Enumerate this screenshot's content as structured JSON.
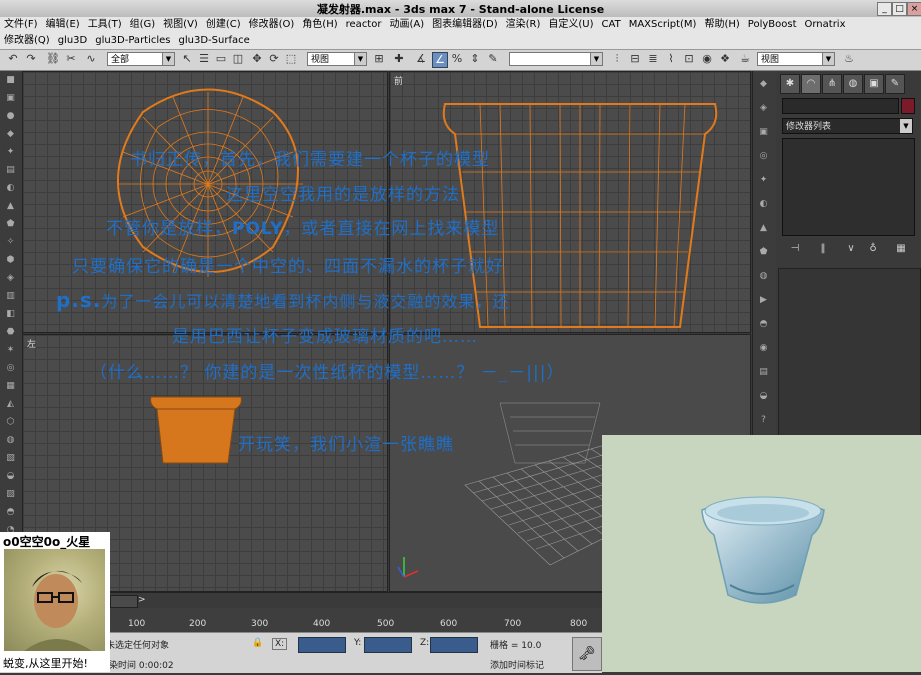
{
  "window": {
    "title": "凝发射器.max - 3ds max 7  - Stand-alone License",
    "controls": [
      "_",
      "□",
      "×"
    ]
  },
  "menu": {
    "row1": [
      "文件(F)",
      "编辑(E)",
      "工具(T)",
      "组(G)",
      "视图(V)",
      "创建(C)",
      "修改器(O)",
      "角色(H)",
      "reactor",
      "动画(A)",
      "图表编辑器(D)",
      "渲染(R)",
      "自定义(U)",
      "CAT",
      "MAXScript(M)",
      "帮助(H)",
      "PolyBoost",
      "Ornatrix"
    ],
    "row2": [
      "修改器(Q)",
      "glu3D",
      "glu3D-Particles",
      "glu3D-Surface"
    ]
  },
  "toolbar": {
    "selection_filter": "全部",
    "ref_coord": "视图",
    "named_selection": "",
    "render_view": "视图"
  },
  "viewports": {
    "top_left_label": "",
    "top_right_label": "前",
    "bottom_left_label": "左",
    "bottom_right_label": ""
  },
  "command_panel": {
    "modifier_list": "修改器列表",
    "color": "#7a1a2a"
  },
  "captions": {
    "line1": "书归正传，首先，我们需要建一个杯子的模型",
    "line2": "这里空空我用的是放样的方法",
    "line3_a": "不管你是放样，",
    "line3_b": "POLY",
    "line3_c": "，或者直接在网上找来模型",
    "line4": "只要确保它的确是一个中空的、四面不漏水的杯子就好",
    "line5_a": "p.s.",
    "line5_b": "为了一会儿可以清楚地看到杯内侧与液交融的效果，还",
    "line6": "是用巴西让杯子变成玻璃材质的吧……",
    "line7": "（什么……？ 你建的是一次性纸杯的模型……？ －_－|||）",
    "line8": "开玩笑，我们小渲一张瞧瞧"
  },
  "timeline": {
    "ticks": [
      "100",
      "200",
      "300",
      "400",
      "500",
      "600",
      "700",
      "800"
    ],
    "arrow": ">"
  },
  "status": {
    "selection": "未选定任何对象",
    "hint": "渲染时间  0:00:02",
    "x_label": "X:",
    "y_label": "Y:",
    "z_label": "Z:",
    "grid": "栅格 = 10.0",
    "add_time_tag": "添加时间标记"
  },
  "avatar": {
    "name": "o0空空0o_火星",
    "caption": "蜕变,从这里开始!"
  },
  "colors": {
    "caption_blue": "#1f6fc8",
    "wire_orange": "#e07a1c",
    "render_bg": "#c9d6bf"
  }
}
